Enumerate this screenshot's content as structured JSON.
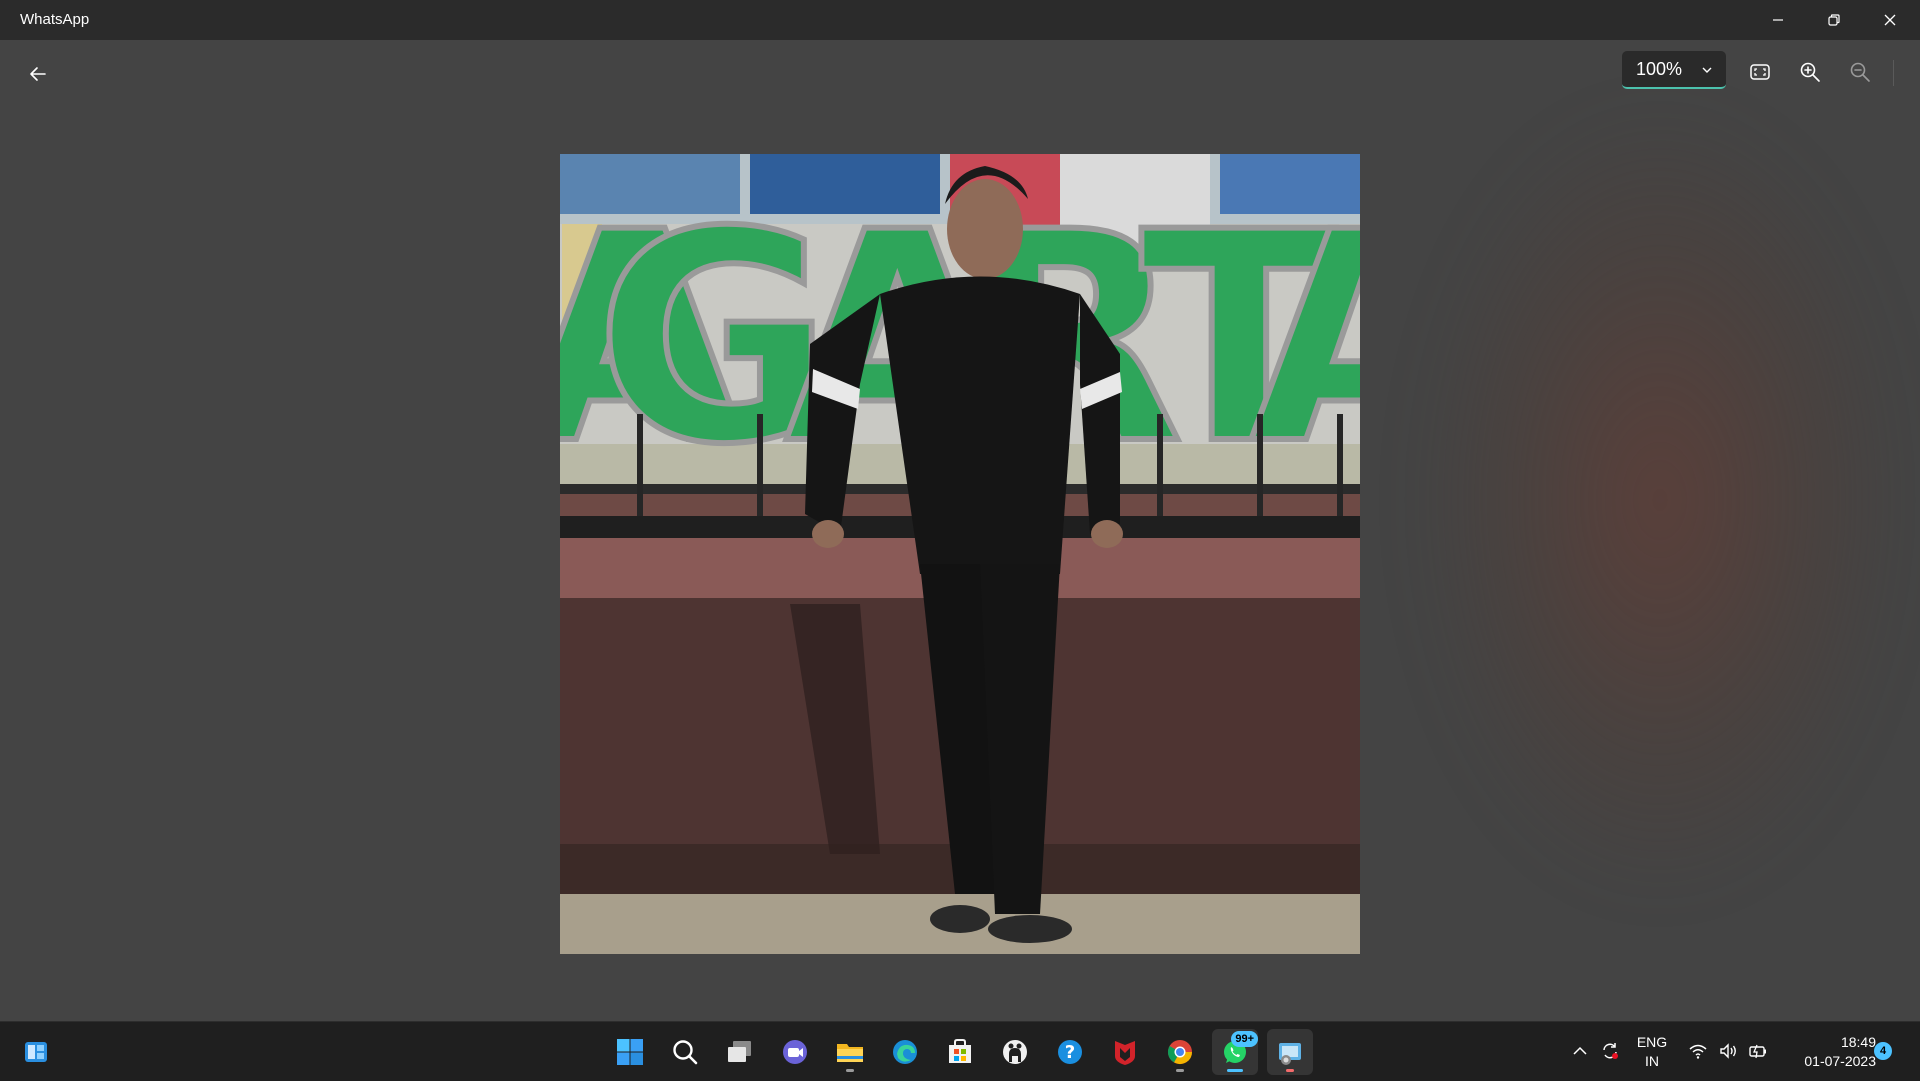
{
  "window": {
    "title": "WhatsApp",
    "controls": [
      "minimize",
      "restore",
      "close"
    ]
  },
  "viewer": {
    "zoom_value": "100%",
    "tools": [
      "fit-to-window-icon",
      "zoom-in-icon",
      "zoom-out-icon"
    ]
  },
  "photo": {
    "description_hidden": true,
    "sign_letters": [
      "G",
      "A",
      "R",
      "T",
      "A"
    ],
    "board_text": "GARTALA"
  },
  "taskbar": {
    "apps": [
      "windows-start-icon",
      "search-icon",
      "task-view-icon",
      "teams-chat-icon",
      "file-explorer-icon",
      "edge-icon",
      "store-icon",
      "github-icon",
      "help-icon",
      "mcafee-icon",
      "chrome-icon",
      "whatsapp-icon",
      "photos-icon"
    ],
    "whatsapp_badge": "99+",
    "tray": {
      "language_line1": "ENG",
      "language_line2": "IN",
      "time": "18:49",
      "date": "01-07-2023",
      "notification_count": "4"
    }
  },
  "colors": {
    "accent": "#4cc2ff",
    "zoom_underline": "#4cc2ad",
    "sign_green": "#2ea55a"
  }
}
